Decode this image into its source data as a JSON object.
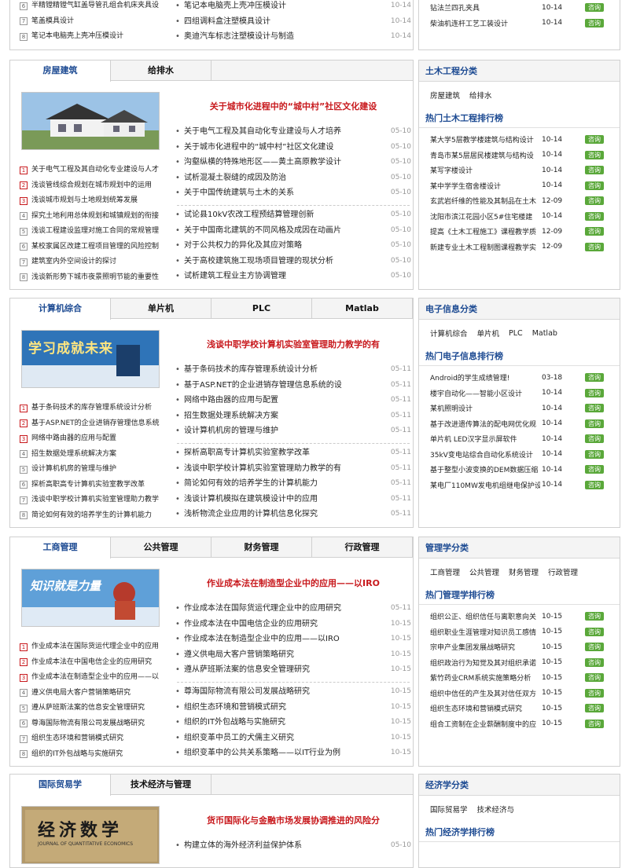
{
  "top": {
    "left_items": [
      {
        "n": "6",
        "title": "半精镗精镗气缸盖导管孔组合机床夹具设"
      },
      {
        "n": "7",
        "title": "笔盖模具设计"
      },
      {
        "n": "8",
        "title": "笔记本电脑壳上壳冲压模设计"
      }
    ],
    "mid_items": [
      {
        "title": "笔记本电脑壳上壳冲压模设计",
        "date": "10-14"
      },
      {
        "title": "四组调料盒注塑模具设计",
        "date": "10-14"
      },
      {
        "title": "奥迪汽车标志注塑模设计与制造",
        "date": "10-14"
      }
    ],
    "rank_items": [
      {
        "title": "钻法兰四孔夹具",
        "date": "10-14",
        "btn": "咨询"
      },
      {
        "title": "柴油机连杆工艺工装设计",
        "date": "10-14",
        "btn": "咨询"
      }
    ]
  },
  "sections": [
    {
      "tabs": [
        "房屋建筑",
        "给排水"
      ],
      "image_text": "",
      "headline": "关于城市化进程中的“城中村”社区文化建设",
      "numbered": [
        "关于电气工程及其自动化专业建设与人才",
        "浅谈管线综合规划在城市规划中的运用",
        "浅谈城市规划与土地规划统筹发展",
        "探究土地利用总体规划和城镇规划的衔接",
        "浅谈工程建设监理对施工合同的常规管理",
        "某校家属区改建工程项目管理的风险控制",
        "建筑室内外空间设计的探讨",
        "浅谈新形势下城市夜景照明节能的重要性"
      ],
      "articles_a": [
        {
          "title": "关于电气工程及其自动化专业建设与人才培养",
          "date": "05-10"
        },
        {
          "title": "关于城市化进程中的“城中村”社区文化建设",
          "date": "05-10"
        },
        {
          "title": "沟壑纵横的特殊地形区——黄土高原教学设计",
          "date": "05-10"
        },
        {
          "title": "试析混凝土裂缝的成因及防治",
          "date": "05-10"
        },
        {
          "title": "关于中国传统建筑与土木的关系",
          "date": "05-10"
        }
      ],
      "articles_b": [
        {
          "title": "试论县10kV农改工程预结算管理创新",
          "date": "05-10"
        },
        {
          "title": "关于中国南北建筑的不同风格及成因在动画片",
          "date": "05-10"
        },
        {
          "title": "对于公共权力的异化及其应对策略",
          "date": "05-10"
        },
        {
          "title": "关于高校建筑施工现场项目管理的现状分析",
          "date": "05-10"
        },
        {
          "title": "试析建筑工程业主方协调管理",
          "date": "05-10"
        }
      ],
      "side_title": "土木工程分类",
      "side_cats": [
        "房屋建筑",
        "给排水"
      ],
      "rank_title": "热门土木工程排行榜",
      "rank": [
        {
          "title": "某大学5层教学楼建筑与结构设计",
          "date": "10-14"
        },
        {
          "title": "青岛市某5层居民楼建筑与结构设",
          "date": "10-14"
        },
        {
          "title": "某写字楼设计",
          "date": "10-14"
        },
        {
          "title": "某中学学生宿舍楼设计",
          "date": "10-14"
        },
        {
          "title": "玄武岩纤维的性能及其制品在土木",
          "date": "12-09"
        },
        {
          "title": "沈阳市滨江花园小区5#住宅楼建",
          "date": "10-14"
        },
        {
          "title": "提高《土木工程施工》课程教学质",
          "date": "12-09"
        },
        {
          "title": "新建专业土木工程制图课程教学实",
          "date": "12-09"
        }
      ]
    },
    {
      "tabs": [
        "计算机综合",
        "单片机",
        "PLC",
        "Matlab"
      ],
      "image_text": "学习成就未来",
      "headline": "浅谈中职学校计算机实验室管理助力教学的有",
      "numbered": [
        "基于条码技术的库存管理系统设计分析",
        "基于ASP.NET的企业进销存管理信息系统",
        "网络中路由器的应用与配置",
        "招生数据处理系统解决方案",
        "设计算机机房的管理与维护",
        "探析高职高专计算机实验室教学改革",
        "浅谈中职学校计算机实验室管理助力教学",
        "简论如何有效的培养学生的计算机能力"
      ],
      "articles_a": [
        {
          "title": "基于条码技术的库存管理系统设计分析",
          "date": "05-11"
        },
        {
          "title": "基于ASP.NET的企业进销存管理信息系统的设",
          "date": "05-11"
        },
        {
          "title": "网络中路由器的应用与配置",
          "date": "05-11"
        },
        {
          "title": "招生数据处理系统解决方案",
          "date": "05-11"
        },
        {
          "title": "设计算机机房的管理与维护",
          "date": "05-11"
        }
      ],
      "articles_b": [
        {
          "title": "探析高职高专计算机实验室教学改革",
          "date": "05-11"
        },
        {
          "title": "浅谈中职学校计算机实验室管理助力教学的有",
          "date": "05-11"
        },
        {
          "title": "简论如何有效的培养学生的计算机能力",
          "date": "05-11"
        },
        {
          "title": "浅谈计算机模拟在建筑模设计中的应用",
          "date": "05-11"
        },
        {
          "title": "浅析物流企业应用的计算机信息化探究",
          "date": "05-11"
        }
      ],
      "side_title": "电子信息分类",
      "side_cats": [
        "计算机综合",
        "单片机",
        "PLC",
        "Matlab"
      ],
      "rank_title": "热门电子信息排行榜",
      "rank": [
        {
          "title": "Android的学生成绩管理!",
          "date": "03-18"
        },
        {
          "title": "楼宇自动化——智能小区设计",
          "date": "10-14"
        },
        {
          "title": "某机照明设计",
          "date": "10-14"
        },
        {
          "title": "基于改进遗传算法的配电网优化规",
          "date": "10-14"
        },
        {
          "title": "单片机 LED汉字显示屏软件",
          "date": "10-14"
        },
        {
          "title": "35kV变电站综合自动化系统设计",
          "date": "10-14"
        },
        {
          "title": "基于整型小波变换的DEM数据压缩",
          "date": "10-14"
        },
        {
          "title": "某电厂110MW发电机组继电保护设",
          "date": "10-14"
        }
      ]
    },
    {
      "tabs": [
        "工商管理",
        "公共管理",
        "财务管理",
        "行政管理"
      ],
      "image_text": "知识就是力量",
      "headline": "作业成本法在制造型企业中的应用——以IRO",
      "numbered": [
        "作业成本法在国际货运代理企业中的应用",
        "作业成本法在中国电信企业的应用研究",
        "作业成本法在制造型企业中的应用——以",
        "遵义供电局大客户营销策略研究",
        "遵从萨班斯法案的信息安全管理研究",
        "尊海国际物流有限公司发展战略研究",
        "组织生态环境和营销模式研究",
        "组织的IT外包战略与实施研究"
      ],
      "articles_a": [
        {
          "title": "作业成本法在国际货运代理企业中的应用研究",
          "date": "05-11"
        },
        {
          "title": "作业成本法在中国电信企业的应用研究",
          "date": "10-15"
        },
        {
          "title": "作业成本法在制造型企业中的应用——以IRO",
          "date": "10-15"
        },
        {
          "title": "遵义供电局大客户营销策略研究",
          "date": "10-15"
        },
        {
          "title": "遵从萨班斯法案的信息安全管理研究",
          "date": "10-15"
        }
      ],
      "articles_b": [
        {
          "title": "尊海国际物流有限公司发展战略研究",
          "date": "10-15"
        },
        {
          "title": "组织生态环境和营销模式研究",
          "date": "10-15"
        },
        {
          "title": "组织的IT外包战略与实施研究",
          "date": "10-15"
        },
        {
          "title": "组织变革中员工的犬儒主义研究",
          "date": "10-15"
        },
        {
          "title": "组织变革中的公共关系策略——以IT行业为例",
          "date": "10-15"
        }
      ],
      "side_title": "管理学分类",
      "side_cats": [
        "工商管理",
        "公共管理",
        "财务管理",
        "行政管理"
      ],
      "rank_title": "热门管理学排行榜",
      "rank": [
        {
          "title": "组织公正、组织信任与离职意向关",
          "date": "10-15"
        },
        {
          "title": "组织职业生涯管理对知识员工感情",
          "date": "10-15"
        },
        {
          "title": "宗申产业集团发展战略研究",
          "date": "10-15"
        },
        {
          "title": "组织政治行为知觉及其对组织承诺",
          "date": "10-15"
        },
        {
          "title": "紫竹药业CRM系统实施策略分析",
          "date": "10-15"
        },
        {
          "title": "组织中信任的产生及其对信任双方",
          "date": "10-15"
        },
        {
          "title": "组织生态环境和营销模式研究",
          "date": "10-15"
        },
        {
          "title": "组合工资制在企业薪酬制度中的应",
          "date": "10-15"
        }
      ]
    },
    {
      "tabs": [
        "国际贸易学",
        "技术经济与管理"
      ],
      "image_text": "经济数学",
      "image_subtext": "JOURNAL OF QUANTITATIVE ECONOMICS",
      "headline": "货币国际化与金融市场发展协调推进的风险分",
      "numbered": [],
      "articles_a": [
        {
          "title": "构建立体的海外经济利益保护体系",
          "date": "05-10"
        }
      ],
      "articles_b": [],
      "side_title": "经济学分类",
      "side_cats": [
        "国际贸易学",
        "技术经济与"
      ],
      "rank_title": "热门经济学排行榜",
      "rank": []
    }
  ],
  "consult_label": "咨询",
  "colors": {
    "accent": "#1c4a92",
    "headline": "#c8191d",
    "button": "#5aa83a",
    "border": "#d0d0d0"
  }
}
